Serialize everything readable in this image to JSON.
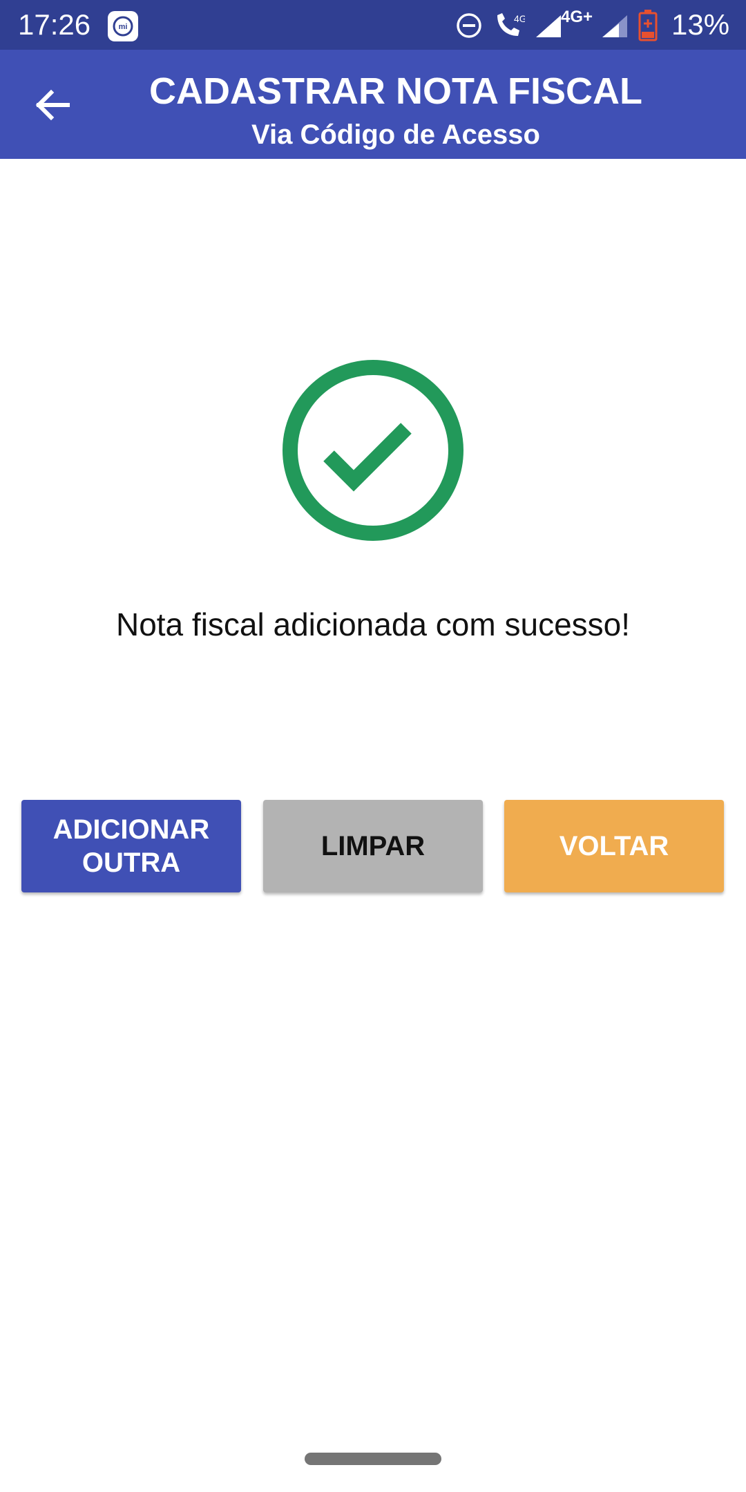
{
  "status_bar": {
    "time": "17:26",
    "network_label": "4G+",
    "call_network_label": "4G",
    "battery_percent": "13%",
    "icons": [
      "mi-icon",
      "dnd-icon",
      "volte-call-icon",
      "signal-icon",
      "signal-icon",
      "battery-low-icon"
    ],
    "colors": {
      "background": "#303f92",
      "battery": "#e8502f"
    }
  },
  "app_bar": {
    "title": "CADASTRAR NOTA FISCAL",
    "subtitle": "Via Código de Acesso",
    "back_icon": "arrow-left-icon",
    "colors": {
      "background": "#4050b5",
      "text": "#ffffff"
    }
  },
  "main": {
    "success_icon": "check-circle-icon",
    "success_color": "#22995a",
    "message": "Nota fiscal adicionada com sucesso!"
  },
  "buttons": {
    "add_another": {
      "label": "ADICIONAR OUTRA",
      "color": "#4050b5"
    },
    "clear": {
      "label": "LIMPAR",
      "color": "#b3b3b3"
    },
    "back": {
      "label": "VOLTAR",
      "color": "#f0ac4f"
    }
  }
}
